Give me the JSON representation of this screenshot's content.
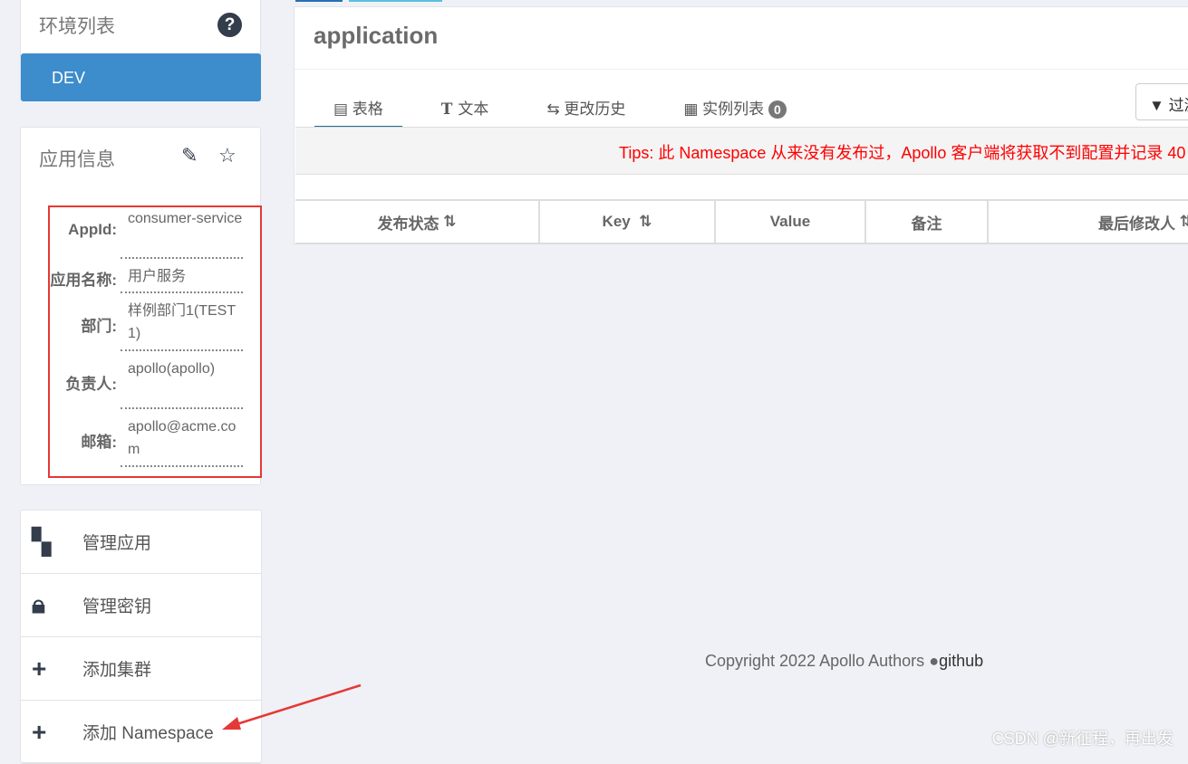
{
  "env": {
    "title": "环境列表",
    "items": [
      "DEV"
    ]
  },
  "app_info": {
    "title": "应用信息",
    "fields": [
      {
        "label": "AppId:",
        "value": "consumer-service"
      },
      {
        "label": "应用名称:",
        "value": "用户服务"
      },
      {
        "label": "部门:",
        "value": "样例部门1(TEST1)"
      },
      {
        "label": "负责人:",
        "value": "apollo(apollo)"
      },
      {
        "label": "邮箱:",
        "value": "apollo@acme.com"
      }
    ]
  },
  "menu": [
    {
      "label": "管理应用",
      "icon": "grid-icon"
    },
    {
      "label": "管理密钥",
      "icon": "lock-icon"
    },
    {
      "label": "添加集群",
      "icon": "plus-icon"
    },
    {
      "label": "添加 Namespace",
      "icon": "plus-icon"
    }
  ],
  "namespace": {
    "title": "application",
    "tabs": [
      {
        "label": "表格"
      },
      {
        "label": "文本"
      },
      {
        "label": "更改历史"
      },
      {
        "label": "实例列表",
        "badge": "0"
      }
    ],
    "filter_label": "过滤",
    "tips": "Tips: 此 Namespace 从来没有发布过，Apollo 客户端将获取不到配置并记录 40",
    "columns": [
      "发布状态",
      "Key",
      "Value",
      "备注",
      "最后修改人"
    ]
  },
  "footer": {
    "copyright": "Copyright 2022 Apollo Authors",
    "link": "github"
  },
  "watermark": "CSDN @新征程，再出发",
  "colors": {
    "accent": "#3d8ccc",
    "annotation": "#e53935",
    "tips": "#ff0000"
  }
}
